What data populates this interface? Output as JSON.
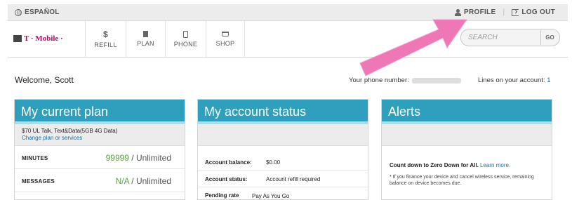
{
  "top_bar": {
    "language_label": "ESPAÑOL",
    "profile_label": "PROFILE",
    "separator": "|",
    "logout_label": "LOG OUT"
  },
  "nav": {
    "brand": "T · Mobile ·",
    "refill_icon": "$",
    "refill_label": "REFILL",
    "plan_label": "PLAN",
    "phone_label": "PHONE",
    "shop_label": "SHOP"
  },
  "search": {
    "placeholder": "SEARCH",
    "go_label": "GO"
  },
  "welcome": {
    "greeting": "Welcome, Scott",
    "phone_label": "Your phone number:",
    "lines_label": "Lines on your account:",
    "lines_count": "1"
  },
  "plan_card": {
    "title": "My current plan",
    "plan_name": "$70 UL Talk, Text&Data(5GB 4G Data)",
    "change_link": "Change plan or services",
    "rows": [
      {
        "label": "MINUTES",
        "highlight": "99999",
        "rest": " / Unlimited"
      },
      {
        "label": "MESSAGES",
        "highlight": "N/A",
        "rest": " / Unlimited"
      }
    ]
  },
  "account_card": {
    "title": "My account status",
    "balance_label": "Account balance:",
    "balance_value": "$0.00",
    "status_label": "Account status:",
    "status_value": "Account refill required",
    "pending_label": "Pending rate plan change:",
    "pending_value": "Pay As You Go"
  },
  "alerts_card": {
    "title": "Alerts",
    "main_text": "Count down to Zero Down for All.",
    "learn_more": "Learn more.",
    "note": "* If you finance your device and cancel wireless service, remaining balance on device becomes due."
  },
  "colors": {
    "card_header": "#2e9fbd",
    "brand_magenta": "#c8006e",
    "highlight_green": "#58a33c",
    "link_blue": "#1d6c9b",
    "annotation_arrow": "#ee78b6"
  }
}
